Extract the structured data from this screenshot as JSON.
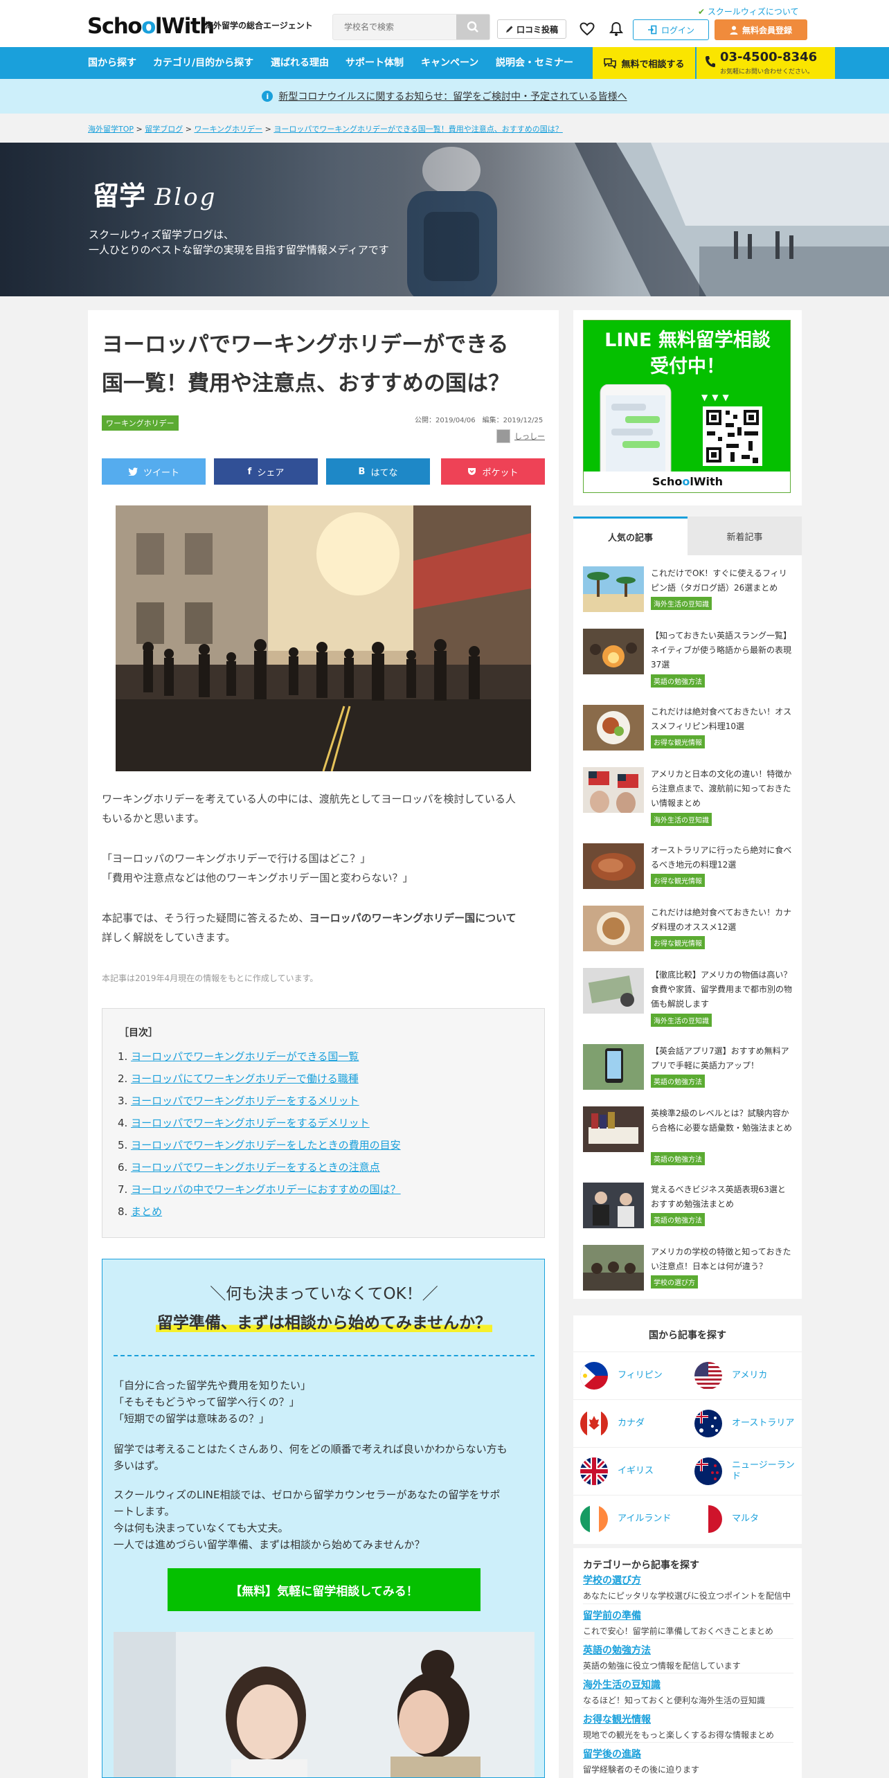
{
  "header": {
    "logo_a": "Scho",
    "logo_w": "o",
    "logo_b": "lWith",
    "tagline": "海外留学の総合エージェント",
    "search_placeholder": "学校名で検索",
    "review_label": "口コミ投稿",
    "about_label": "スクールウィズについて",
    "login_label": "ログイン",
    "register_label": "無料会員登録"
  },
  "nav": {
    "items": [
      "国から探す",
      "カテゴリ/目的から探す",
      "選ばれる理由",
      "サポート体制",
      "キャンペーン",
      "説明会・セミナー"
    ],
    "consult_label": "無料で相談する",
    "phone": "03-4500-8346",
    "phone_sub": "お気軽にお問い合わせください。"
  },
  "notice": {
    "text": "新型コロナウイルスに関するお知らせ：留学をご検討中・予定されている皆様へ"
  },
  "breadcrumb": [
    "海外留学TOP",
    "留学ブログ",
    "ワーキングホリデー",
    "ヨーロッパでワーキングホリデーができる国一覧！費用や注意点、おすすめの国は？"
  ],
  "hero": {
    "title_ja": "留学",
    "title_en": "Blog",
    "line1": "スクールウィズ留学ブログは、",
    "line2": "一人ひとりのベストな留学の実現を目指す留学情報メディアです"
  },
  "article": {
    "title_line1": "ヨーロッパでワーキングホリデーができる",
    "title_line2": "国一覧！費用や注意点、おすすめの国は？",
    "tag": "ワーキングホリデー",
    "published": "公開：2019/04/06",
    "edited": "編集：2019/12/25",
    "author": "しっしー",
    "share": [
      "ツイート",
      "シェア",
      "はてな",
      "ポケット"
    ],
    "p1_line1": "ワーキングホリデーを考えている人の中には、渡航先としてヨーロッパを検討している人",
    "p1_line2": "もいるかと思います。",
    "q1": "「ヨーロッパのワーキングホリデーで行ける国はどこ？」",
    "q2": "「費用や注意点などは他のワーキングホリデー国と変わらない？」",
    "p3_a": "本記事では、そう行った疑問に答えるため、",
    "p3_bold": "ヨーロッパのワーキングホリデー国について",
    "p3_b": "詳しく解説をしていきます。",
    "note": "本記事は2019年4月現在の情報をもとに作成しています。",
    "toc_title": "［目次］",
    "toc": [
      {
        "n": "1.",
        "t": "ヨーロッパでワーキングホリデーができる国一覧"
      },
      {
        "n": "2.",
        "t": "ヨーロッパにてワーキングホリデーで働ける職種"
      },
      {
        "n": "3.",
        "t": "ヨーロッパでワーキングホリデーをするメリット"
      },
      {
        "n": "4.",
        "t": "ヨーロッパでワーキングホリデーをするデメリット"
      },
      {
        "n": "5.",
        "t": "ヨーロッパでワーキングホリデーをしたときの費用の目安"
      },
      {
        "n": "6.",
        "t": "ヨーロッパでワーキングホリデーをするときの注意点"
      },
      {
        "n": "7.",
        "t": "ヨーロッパの中でワーキングホリデーにおすすめの国は？"
      },
      {
        "n": "8.",
        "t": "まとめ"
      }
    ]
  },
  "cta": {
    "t1": "＼何も決まっていなくてOK！／",
    "t2": "留学準備、まずは相談から始めてみませんか？",
    "q1": "「自分に合った留学先や費用を知りたい」",
    "q2": "「そもそもどうやって留学へ行くの？」",
    "q3": "「短期での留学は意味あるの？」",
    "p1_line1": "留学では考えることはたくさんあり、何をどの順番で考えれば良いかわからない方も",
    "p1_line2": "多いはず。",
    "p2_line1": "スクールウィズのLINE相談では、ゼロから留学カウンセラーがあなたの留学をサポ",
    "p2_line2": "ートします。",
    "p2_line3": "今は何も決まっていなくても大丈夫。",
    "p2_line4": "一人では進めづらい留学準備、まずは相談から始めてみませんか？",
    "button": "【無料】気軽に留学相談してみる！"
  },
  "line_ad": {
    "line1": "LINE 無料留学相談",
    "line2": "受付中！",
    "foot_a": "Scho",
    "foot_w": "o",
    "foot_b": "lWith"
  },
  "ranking": {
    "tab_popular": "人気の記事",
    "tab_new": "新着記事",
    "items": [
      {
        "title": "これだけでOK！すぐに使えるフィリピン語（タガログ語）26選まとめ",
        "tag": "海外生活の豆知識"
      },
      {
        "title": "【知っておきたい英語スラング一覧】ネイティブが使う略語から最新の表現37選",
        "tag": "英語の勉強方法"
      },
      {
        "title": "これだけは絶対食べておきたい！オススメフィリピン料理10選",
        "tag": "お得な観光情報"
      },
      {
        "title": "アメリカと日本の文化の違い！特徴から注意点まで、渡航前に知っておきたい情報まとめ",
        "tag": "海外生活の豆知識"
      },
      {
        "title": "オーストラリアに行ったら絶対に食べるべき地元の料理12選",
        "tag": "お得な観光情報"
      },
      {
        "title": "これだけは絶対食べておきたい！カナダ料理のオススメ12選",
        "tag": "お得な観光情報"
      },
      {
        "title": "【徹底比較】アメリカの物価は高い？食費や家賃、留学費用まで都市別の物価も解説します",
        "tag": "海外生活の豆知識"
      },
      {
        "title": "【英会話アプリ7選】おすすめ無料アプリで手軽に英語力アップ！",
        "tag": "英語の勉強方法"
      },
      {
        "title": "英検準2級のレベルとは？試験内容から合格に必要な語彙数・勉強法まとめ",
        "tag": "英語の勉強方法"
      },
      {
        "title": "覚えるべきビジネス英語表現63選とおすすめ勉強法まとめ",
        "tag": "英語の勉強方法"
      },
      {
        "title": "アメリカの学校の特徴と知っておきたい注意点！日本とは何が違う？",
        "tag": "学校の選び方"
      }
    ]
  },
  "countries": {
    "title": "国から記事を探す",
    "items": [
      "フィリピン",
      "アメリカ",
      "カナダ",
      "オーストラリア",
      "イギリス",
      "ニュージーランド",
      "アイルランド",
      "マルタ"
    ]
  },
  "categories": {
    "title": "カテゴリーから記事を探す",
    "items": [
      {
        "name": "学校の選び方",
        "desc": "あなたにピッタリな学校選びに役立つポイントを配信中"
      },
      {
        "name": "留学前の準備",
        "desc": "これで安心！留学前に準備しておくべきことまとめ"
      },
      {
        "name": "英語の勉強方法",
        "desc": "英語の勉強に役立つ情報を配信しています"
      },
      {
        "name": "海外生活の豆知識",
        "desc": "なるほど！知っておくと便利な海外生活の豆知識"
      },
      {
        "name": "お得な観光情報",
        "desc": "現地での観光をもっと楽しくするお得な情報まとめ"
      },
      {
        "name": "留学後の進路",
        "desc": "留学経験者のその後に迫ります"
      }
    ]
  },
  "colors": {
    "brand_blue": "#1aa0db",
    "line_green": "#05c000",
    "tag_green": "#5bab32",
    "accent_orange": "#f08b3c",
    "yellow": "#fae500"
  }
}
